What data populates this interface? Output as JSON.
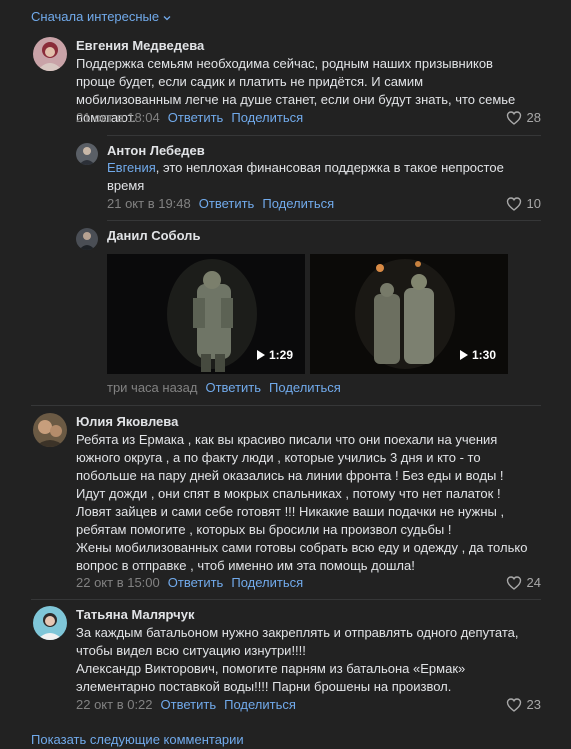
{
  "sort_label": "Сначала интересные",
  "comments": [
    {
      "author": "Евгения Медведева",
      "text": "Поддержка семьям необходима сейчас, родным наших призывников проще будет, если садик и платить не придётся. И самим мобилизованным легче на душе станет, если они будут знать, что семье помогают.",
      "time": "21 окт в 18:04",
      "reply": "Ответить",
      "share": "Поделиться",
      "likes": "28"
    },
    {
      "author": "Антон Лебедев",
      "mention": "Евгения",
      "text": ", это неплохая финансовая поддержка в такое непростое время",
      "time": "21 окт в 19:48",
      "reply": "Ответить",
      "share": "Поделиться",
      "likes": "10"
    },
    {
      "author": "Данил Соболь",
      "videos": [
        {
          "duration": "1:29"
        },
        {
          "duration": "1:30"
        }
      ],
      "time": "три часа назад",
      "reply": "Ответить",
      "share": "Поделиться"
    },
    {
      "author": "Юлия Яковлева",
      "text": "Ребята из Ермака , как вы красиво писали что они поехали на учения южного округа , а по факту люди , которые учились 3 дня и кто - то побольше на пару дней оказались на линии фронта ! Без еды и воды ! Идут дожди , они спят в мокрых спальниках , потому что нет палаток ! Ловят зайцев и сами себе готовят !!! Никакие ваши подачки не нужны , ребятам помогите , которых вы бросили на произвол судьбы !\nЖены мобилизованных сами готовы собрать всю еду и одежду , да только вопрос в отправке , чтоб именно им эта помощь дошла!",
      "time": "22 окт в 15:00",
      "reply": "Ответить",
      "share": "Поделиться",
      "likes": "24"
    },
    {
      "author": "Татьяна Малярчук",
      "text": "За каждым батальоном нужно закреплять и отправлять одного депутата, чтобы видел всю ситуацию изнутри!!!!\nАлександр Викторович, помогите парням из батальона «Ермак» элементарно поставкой воды!!!! Парни брошены на произвол.",
      "time": "22 окт в 0:22",
      "reply": "Ответить",
      "share": "Поделиться",
      "likes": "23"
    }
  ],
  "show_more": "Показать следующие комментарии",
  "icons": {
    "like": "heart-icon",
    "play": "play-icon",
    "sort": "chevron-down-icon"
  },
  "colors": {
    "background": "#222222",
    "link": "#71aaeb",
    "muted": "#828282",
    "text": "#e1e3e6"
  }
}
